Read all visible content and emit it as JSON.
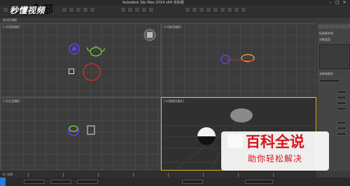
{
  "window": {
    "title": "Autodesk 3ds Max 2014 x64  无标题"
  },
  "toolbar": {
    "selection_filter": "全部"
  },
  "ribbon": {
    "label": "多边形建模"
  },
  "viewports": [
    {
      "label": "[+][顶][线框]"
    },
    {
      "label": "[+][前][线框]"
    },
    {
      "label": "[+][左][线框]"
    },
    {
      "label": "[+][透视][真实]"
    }
  ],
  "command_panel": {
    "label_a": "标准基本体",
    "label_b": "对象类型",
    "label_c": "名称和颜色"
  },
  "timeline": {
    "frame": "0 / 100"
  },
  "watermark": {
    "text": "秒懂视频"
  },
  "baike": {
    "title": "百科全说",
    "subtitle": "助你轻松解决"
  },
  "icons": [
    "minimize-icon",
    "maximize-icon",
    "close-icon",
    "teapot-icon",
    "sphere-icon",
    "camera-icon",
    "light-icon",
    "box-icon"
  ],
  "colors": {
    "accent_yellow": "#e3c12a",
    "object_green": "#7bdc2a",
    "light_purple": "#6a3cff",
    "camera_red": "#c32b2b",
    "baike_red": "#d9141b"
  }
}
